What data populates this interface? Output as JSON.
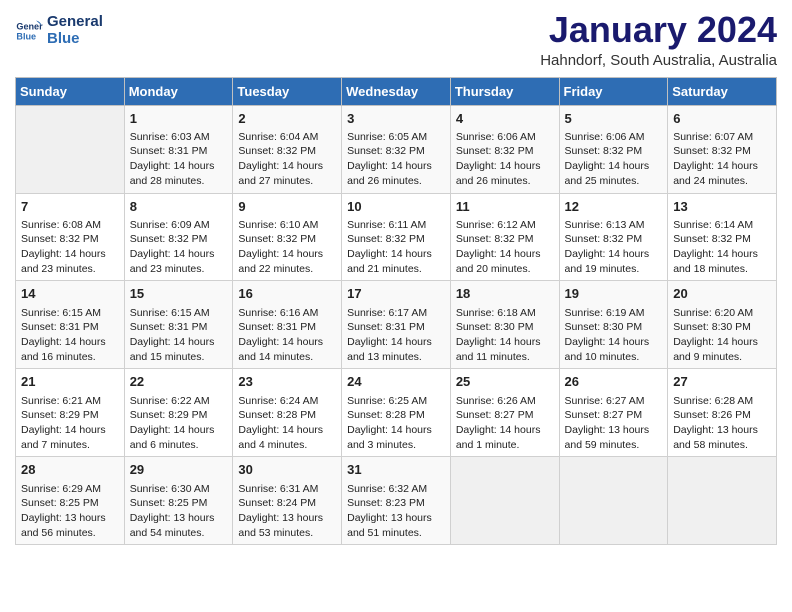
{
  "header": {
    "logo_line1": "General",
    "logo_line2": "Blue",
    "title": "January 2024",
    "subtitle": "Hahndorf, South Australia, Australia"
  },
  "weekdays": [
    "Sunday",
    "Monday",
    "Tuesday",
    "Wednesday",
    "Thursday",
    "Friday",
    "Saturday"
  ],
  "weeks": [
    [
      {
        "day": "",
        "info": ""
      },
      {
        "day": "1",
        "info": "Sunrise: 6:03 AM\nSunset: 8:31 PM\nDaylight: 14 hours\nand 28 minutes."
      },
      {
        "day": "2",
        "info": "Sunrise: 6:04 AM\nSunset: 8:32 PM\nDaylight: 14 hours\nand 27 minutes."
      },
      {
        "day": "3",
        "info": "Sunrise: 6:05 AM\nSunset: 8:32 PM\nDaylight: 14 hours\nand 26 minutes."
      },
      {
        "day": "4",
        "info": "Sunrise: 6:06 AM\nSunset: 8:32 PM\nDaylight: 14 hours\nand 26 minutes."
      },
      {
        "day": "5",
        "info": "Sunrise: 6:06 AM\nSunset: 8:32 PM\nDaylight: 14 hours\nand 25 minutes."
      },
      {
        "day": "6",
        "info": "Sunrise: 6:07 AM\nSunset: 8:32 PM\nDaylight: 14 hours\nand 24 minutes."
      }
    ],
    [
      {
        "day": "7",
        "info": "Sunrise: 6:08 AM\nSunset: 8:32 PM\nDaylight: 14 hours\nand 23 minutes."
      },
      {
        "day": "8",
        "info": "Sunrise: 6:09 AM\nSunset: 8:32 PM\nDaylight: 14 hours\nand 23 minutes."
      },
      {
        "day": "9",
        "info": "Sunrise: 6:10 AM\nSunset: 8:32 PM\nDaylight: 14 hours\nand 22 minutes."
      },
      {
        "day": "10",
        "info": "Sunrise: 6:11 AM\nSunset: 8:32 PM\nDaylight: 14 hours\nand 21 minutes."
      },
      {
        "day": "11",
        "info": "Sunrise: 6:12 AM\nSunset: 8:32 PM\nDaylight: 14 hours\nand 20 minutes."
      },
      {
        "day": "12",
        "info": "Sunrise: 6:13 AM\nSunset: 8:32 PM\nDaylight: 14 hours\nand 19 minutes."
      },
      {
        "day": "13",
        "info": "Sunrise: 6:14 AM\nSunset: 8:32 PM\nDaylight: 14 hours\nand 18 minutes."
      }
    ],
    [
      {
        "day": "14",
        "info": "Sunrise: 6:15 AM\nSunset: 8:31 PM\nDaylight: 14 hours\nand 16 minutes."
      },
      {
        "day": "15",
        "info": "Sunrise: 6:15 AM\nSunset: 8:31 PM\nDaylight: 14 hours\nand 15 minutes."
      },
      {
        "day": "16",
        "info": "Sunrise: 6:16 AM\nSunset: 8:31 PM\nDaylight: 14 hours\nand 14 minutes."
      },
      {
        "day": "17",
        "info": "Sunrise: 6:17 AM\nSunset: 8:31 PM\nDaylight: 14 hours\nand 13 minutes."
      },
      {
        "day": "18",
        "info": "Sunrise: 6:18 AM\nSunset: 8:30 PM\nDaylight: 14 hours\nand 11 minutes."
      },
      {
        "day": "19",
        "info": "Sunrise: 6:19 AM\nSunset: 8:30 PM\nDaylight: 14 hours\nand 10 minutes."
      },
      {
        "day": "20",
        "info": "Sunrise: 6:20 AM\nSunset: 8:30 PM\nDaylight: 14 hours\nand 9 minutes."
      }
    ],
    [
      {
        "day": "21",
        "info": "Sunrise: 6:21 AM\nSunset: 8:29 PM\nDaylight: 14 hours\nand 7 minutes."
      },
      {
        "day": "22",
        "info": "Sunrise: 6:22 AM\nSunset: 8:29 PM\nDaylight: 14 hours\nand 6 minutes."
      },
      {
        "day": "23",
        "info": "Sunrise: 6:24 AM\nSunset: 8:28 PM\nDaylight: 14 hours\nand 4 minutes."
      },
      {
        "day": "24",
        "info": "Sunrise: 6:25 AM\nSunset: 8:28 PM\nDaylight: 14 hours\nand 3 minutes."
      },
      {
        "day": "25",
        "info": "Sunrise: 6:26 AM\nSunset: 8:27 PM\nDaylight: 14 hours\nand 1 minute."
      },
      {
        "day": "26",
        "info": "Sunrise: 6:27 AM\nSunset: 8:27 PM\nDaylight: 13 hours\nand 59 minutes."
      },
      {
        "day": "27",
        "info": "Sunrise: 6:28 AM\nSunset: 8:26 PM\nDaylight: 13 hours\nand 58 minutes."
      }
    ],
    [
      {
        "day": "28",
        "info": "Sunrise: 6:29 AM\nSunset: 8:25 PM\nDaylight: 13 hours\nand 56 minutes."
      },
      {
        "day": "29",
        "info": "Sunrise: 6:30 AM\nSunset: 8:25 PM\nDaylight: 13 hours\nand 54 minutes."
      },
      {
        "day": "30",
        "info": "Sunrise: 6:31 AM\nSunset: 8:24 PM\nDaylight: 13 hours\nand 53 minutes."
      },
      {
        "day": "31",
        "info": "Sunrise: 6:32 AM\nSunset: 8:23 PM\nDaylight: 13 hours\nand 51 minutes."
      },
      {
        "day": "",
        "info": ""
      },
      {
        "day": "",
        "info": ""
      },
      {
        "day": "",
        "info": ""
      }
    ]
  ]
}
